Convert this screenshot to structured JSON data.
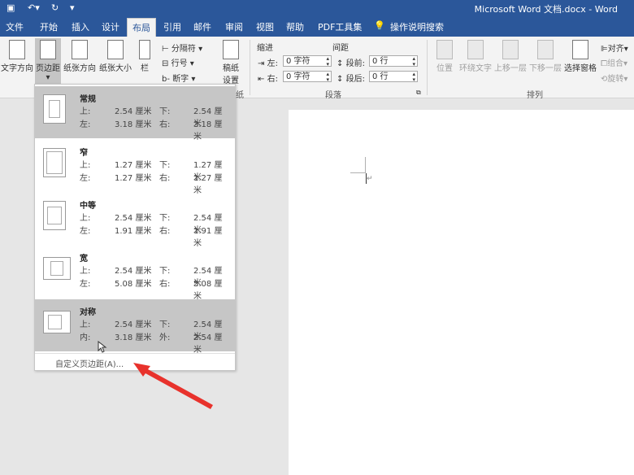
{
  "window_title": "Microsoft Word 文档.docx - Word",
  "quick_access": [
    "save-icon",
    "undo-icon",
    "redo-icon",
    "customize-icon"
  ],
  "tabs": [
    "文件",
    "开始",
    "插入",
    "设计",
    "布局",
    "引用",
    "邮件",
    "审阅",
    "视图",
    "帮助",
    "PDF工具集",
    "操作说明搜索"
  ],
  "active_tab": "布局",
  "ribbon": {
    "page_setup": {
      "text_direction": "文字方向",
      "margins": "页边距",
      "orientation": "纸张方向",
      "size": "纸张大小",
      "columns": "栏",
      "breaks": "分隔符",
      "line_numbers": "行号",
      "hyphenation": "断字",
      "draft_paper_line1": "稿纸",
      "draft_paper_line2": "设置",
      "group_label": "纸"
    },
    "paragraph": {
      "indent_label": "缩进",
      "spacing_label": "间距",
      "left_label": "左:",
      "left_value": "0 字符",
      "right_label": "右:",
      "right_value": "0 字符",
      "before_label": "段前:",
      "before_value": "0 行",
      "after_label": "段后:",
      "after_value": "0 行",
      "group_label": "段落"
    },
    "arrange": {
      "position": "位置",
      "wrap_text": "环绕文字",
      "bring_forward": "上移一层",
      "send_backward": "下移一层",
      "selection_pane": "选择窗格",
      "align": "对齐",
      "group": "组合",
      "rotate": "旋转",
      "group_label": "排列"
    }
  },
  "margins_menu": {
    "presets": [
      {
        "name": "常规",
        "l1": "上:",
        "v1": "2.54 厘米",
        "l2": "下:",
        "v2": "2.54 厘米",
        "l3": "左:",
        "v3": "3.18 厘米",
        "l4": "右:",
        "v4": "3.18 厘米"
      },
      {
        "name": "窄",
        "l1": "上:",
        "v1": "1.27 厘米",
        "l2": "下:",
        "v2": "1.27 厘米",
        "l3": "左:",
        "v3": "1.27 厘米",
        "l4": "右:",
        "v4": "1.27 厘米"
      },
      {
        "name": "中等",
        "l1": "上:",
        "v1": "2.54 厘米",
        "l2": "下:",
        "v2": "2.54 厘米",
        "l3": "左:",
        "v3": "1.91 厘米",
        "l4": "右:",
        "v4": "1.91 厘米"
      },
      {
        "name": "宽",
        "l1": "上:",
        "v1": "2.54 厘米",
        "l2": "下:",
        "v2": "2.54 厘米",
        "l3": "左:",
        "v3": "5.08 厘米",
        "l4": "右:",
        "v4": "5.08 厘米"
      },
      {
        "name": "对称",
        "l1": "上:",
        "v1": "2.54 厘米",
        "l2": "下:",
        "v2": "2.54 厘米",
        "l3": "内:",
        "v3": "3.18 厘米",
        "l4": "外:",
        "v4": "2.54 厘米"
      }
    ],
    "selected": "对称",
    "custom": "自定义页边距(A)..."
  },
  "colors": {
    "title_bar": "#2b579a",
    "ribbon": "#f3f3f3",
    "annotation_arrow": "#e8322c"
  }
}
